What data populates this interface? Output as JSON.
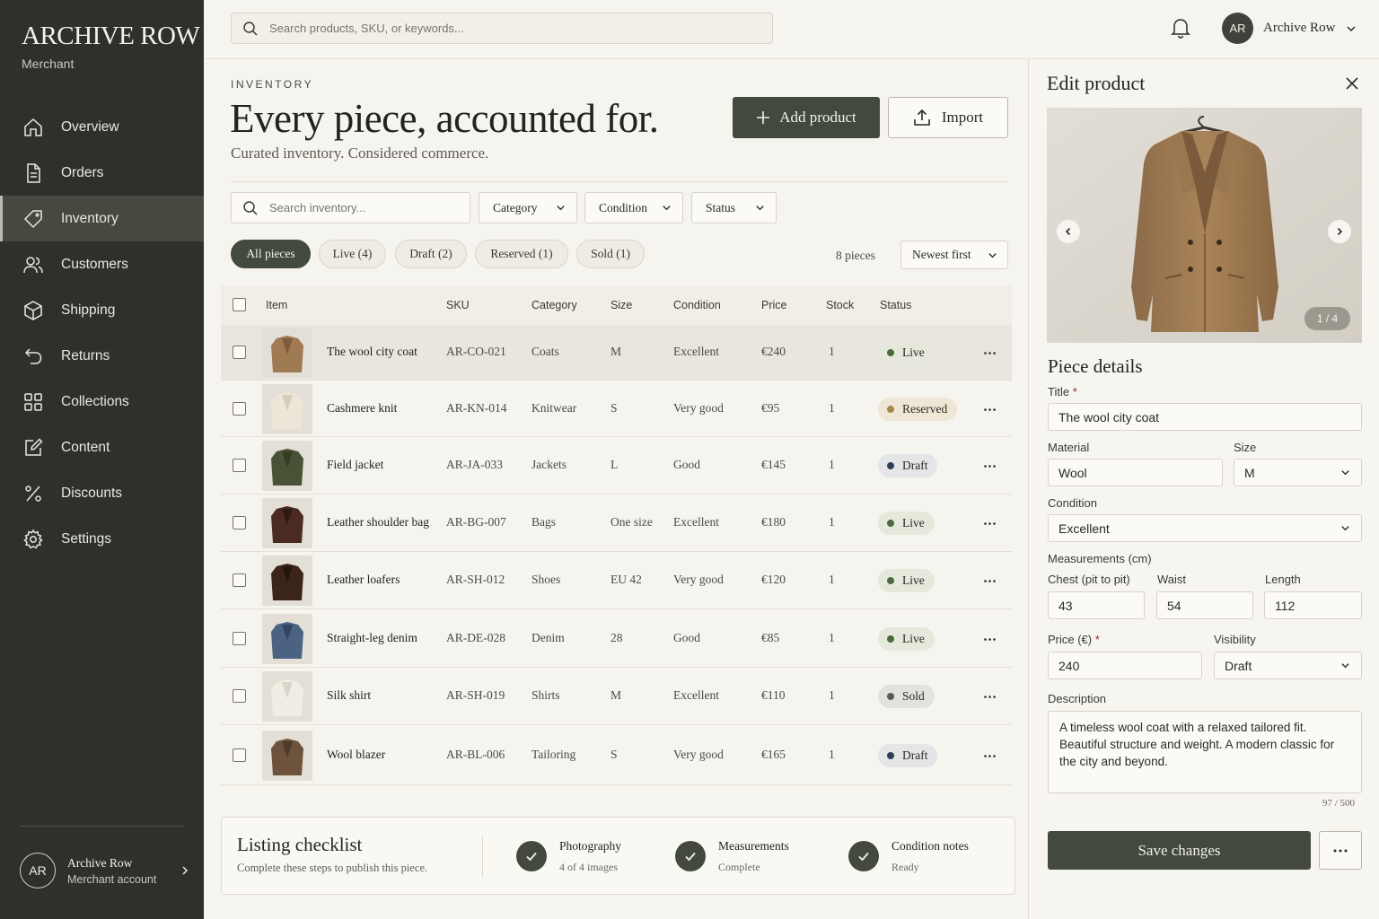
{
  "brand": {
    "name": "ARCHIVE ROW",
    "subtitle": "Merchant"
  },
  "nav": [
    {
      "label": "Overview",
      "icon": "home-icon"
    },
    {
      "label": "Orders",
      "icon": "document-icon"
    },
    {
      "label": "Inventory",
      "icon": "tag-icon",
      "active": true
    },
    {
      "label": "Customers",
      "icon": "users-icon"
    },
    {
      "label": "Shipping",
      "icon": "box-icon"
    },
    {
      "label": "Returns",
      "icon": "return-icon"
    },
    {
      "label": "Collections",
      "icon": "grid-icon"
    },
    {
      "label": "Content",
      "icon": "edit-icon"
    },
    {
      "label": "Discounts",
      "icon": "percent-icon"
    },
    {
      "label": "Settings",
      "icon": "gear-icon"
    }
  ],
  "account": {
    "initials": "AR",
    "name": "Archive Row",
    "role": "Merchant account"
  },
  "topbar": {
    "search_placeholder": "Search products, SKU, or keywords...",
    "user_initials": "AR",
    "user_name": "Archive Row"
  },
  "header": {
    "eyebrow": "INVENTORY",
    "title": "Every piece, accounted for.",
    "subtitle": "Curated inventory. Considered commerce.",
    "add_label": "Add product",
    "import_label": "Import"
  },
  "filters": {
    "search_placeholder": "Search inventory...",
    "category": "Category",
    "condition": "Condition",
    "status": "Status"
  },
  "tabs": [
    "All pieces",
    "Live (4)",
    "Draft (2)",
    "Reserved (1)",
    "Sold (1)"
  ],
  "count": "8 pieces",
  "sort": "Newest first",
  "table": {
    "columns": [
      "Item",
      "SKU",
      "Category",
      "Size",
      "Condition",
      "Price",
      "Stock",
      "Status"
    ],
    "rows": [
      {
        "item": "The wool city coat",
        "sku": "AR-CO-021",
        "category": "Coats",
        "size": "M",
        "condition": "Excellent",
        "price": "€240",
        "stock": "1",
        "status": "Live"
      },
      {
        "item": "Cashmere knit",
        "sku": "AR-KN-014",
        "category": "Knitwear",
        "size": "S",
        "condition": "Very good",
        "price": "€95",
        "stock": "1",
        "status": "Reserved"
      },
      {
        "item": "Field jacket",
        "sku": "AR-JA-033",
        "category": "Jackets",
        "size": "L",
        "condition": "Good",
        "price": "€145",
        "stock": "1",
        "status": "Draft"
      },
      {
        "item": "Leather shoulder bag",
        "sku": "AR-BG-007",
        "category": "Bags",
        "size": "One size",
        "condition": "Excellent",
        "price": "€180",
        "stock": "1",
        "status": "Live"
      },
      {
        "item": "Leather loafers",
        "sku": "AR-SH-012",
        "category": "Shoes",
        "size": "EU 42",
        "condition": "Very good",
        "price": "€120",
        "stock": "1",
        "status": "Live"
      },
      {
        "item": "Straight-leg denim",
        "sku": "AR-DE-028",
        "category": "Denim",
        "size": "28",
        "condition": "Good",
        "price": "€85",
        "stock": "1",
        "status": "Live"
      },
      {
        "item": "Silk shirt",
        "sku": "AR-SH-019",
        "category": "Shirts",
        "size": "M",
        "condition": "Excellent",
        "price": "€110",
        "stock": "1",
        "status": "Sold"
      },
      {
        "item": "Wool blazer",
        "sku": "AR-BL-006",
        "category": "Tailoring",
        "size": "S",
        "condition": "Very good",
        "price": "€165",
        "stock": "1",
        "status": "Draft"
      }
    ]
  },
  "status_colors": {
    "Live": {
      "bg": "#e6e8dc",
      "dot": "#4b6b3a"
    },
    "Reserved": {
      "bg": "#efe7d6",
      "dot": "#a8864a"
    },
    "Draft": {
      "bg": "#e3e5e6",
      "dot": "#2f3f5a"
    },
    "Sold": {
      "bg": "#e3e2dc",
      "dot": "#5a5a55"
    }
  },
  "checklist": {
    "title": "Listing checklist",
    "subtitle": "Complete these steps to publish this piece.",
    "steps": [
      {
        "title": "Photography",
        "detail": "4 of 4 images"
      },
      {
        "title": "Measurements",
        "detail": "Complete"
      },
      {
        "title": "Condition notes",
        "detail": "Ready"
      }
    ]
  },
  "panel": {
    "title": "Edit product",
    "pager": "1 / 4",
    "section": "Piece details",
    "labels": {
      "title": "Title",
      "material": "Material",
      "size": "Size",
      "condition": "Condition",
      "measurements": "Measurements (cm)",
      "chest": "Chest (pit to pit)",
      "waist": "Waist",
      "length": "Length",
      "price": "Price (€)",
      "visibility": "Visibility",
      "description": "Description"
    },
    "values": {
      "title": "The wool city coat",
      "material": "Wool",
      "size": "M",
      "condition": "Excellent",
      "chest": "43",
      "waist": "54",
      "length": "112",
      "price": "240",
      "visibility": "Draft",
      "description": "A timeless wool coat with a relaxed tailored fit. Beautiful structure and weight. A modern classic for the city and beyond."
    },
    "char_count": "97 / 500",
    "save_label": "Save changes"
  }
}
